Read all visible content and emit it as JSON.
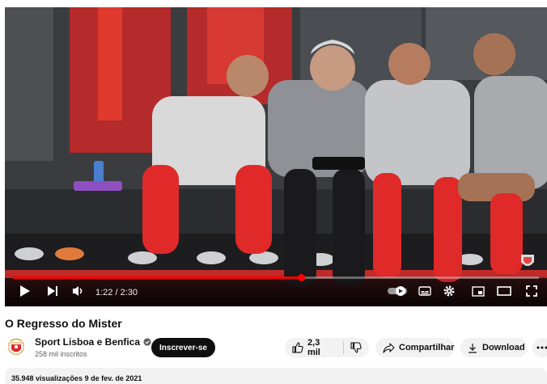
{
  "player": {
    "time_display": "1:22 / 2:30",
    "progress_fraction": 0.547,
    "accent_color": "#ff0000",
    "icons": [
      "play-icon",
      "next-icon",
      "volume-icon",
      "autoplay-icon",
      "subtitles-icon",
      "settings-icon",
      "miniplayer-icon",
      "theater-icon",
      "fullscreen-icon"
    ]
  },
  "video": {
    "title": "O Regresso do Mister"
  },
  "channel": {
    "name": "Sport Lisboa e Benfica",
    "subscribers": "258 mil inscritos",
    "subscribe_label": "Inscrever-se"
  },
  "actions": {
    "likes": "2,3 mil",
    "share_label": "Compartilhar",
    "download_label": "Download"
  },
  "description": {
    "meta": "35.948 visualizações  9 de fev. de 2021"
  }
}
